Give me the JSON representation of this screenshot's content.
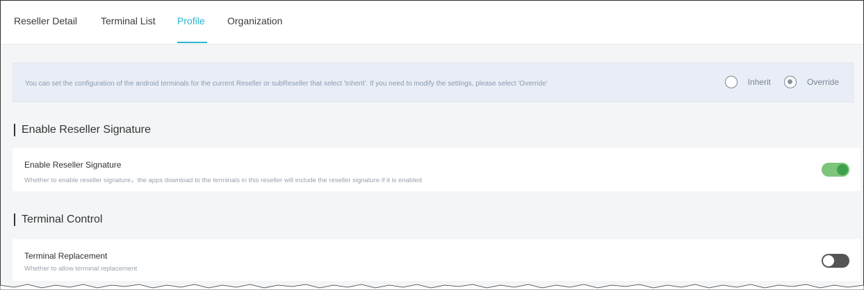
{
  "tabs": [
    {
      "label": "Reseller Detail",
      "active": false
    },
    {
      "label": "Terminal List",
      "active": false
    },
    {
      "label": "Profile",
      "active": true
    },
    {
      "label": "Organization",
      "active": false
    }
  ],
  "notice": {
    "text": "You can set the configuration of the android terminals for the current Reseller or subReseller that select 'Inherit'. If you need to modify the settings, please select 'Override'",
    "options": [
      {
        "label": "Inherit",
        "checked": false
      },
      {
        "label": "Override",
        "checked": true
      }
    ]
  },
  "sections": [
    {
      "title": "Enable Reseller Signature",
      "setting": {
        "label": "Enable Reseller Signature",
        "description": "Whether to enable reseller signature，the apps download to the terminals in this reseller will include the reseller signature if it is enabled",
        "enabled": true
      }
    },
    {
      "title": "Terminal Control",
      "setting": {
        "label": "Terminal Replacement",
        "description": "Whether to allow terminal replacement",
        "enabled": false
      }
    }
  ],
  "colors": {
    "accent": "#2ab5d0",
    "toggle_on": "#3ea24a",
    "toggle_off": "#555555"
  }
}
